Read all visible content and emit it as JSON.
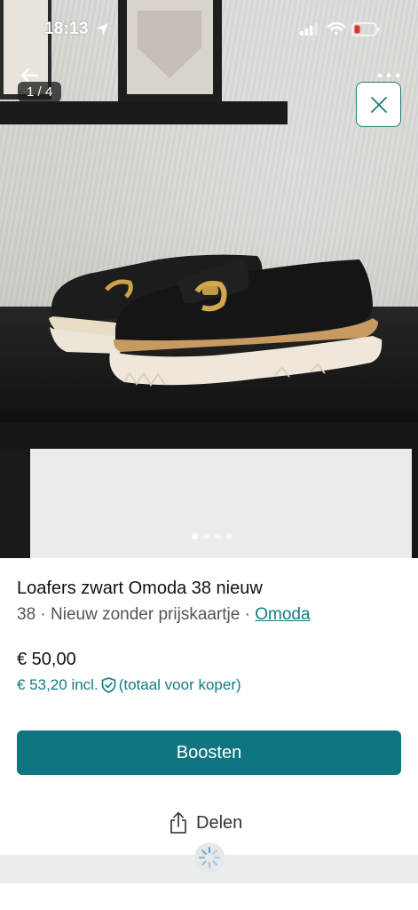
{
  "status_bar": {
    "time": "18:13",
    "icons": [
      "location-arrow-icon",
      "signal-icon",
      "wifi-icon",
      "battery-low-icon"
    ]
  },
  "gallery": {
    "counter": "1 / 4",
    "total_images": 4,
    "active_index": 1
  },
  "listing": {
    "title": "Loafers zwart Omoda 38 nieuw",
    "size": "38",
    "separator": "·",
    "condition": "Nieuw zonder prijskaartje",
    "brand": "Omoda",
    "price": "€ 50,00",
    "price_incl": "€ 53,20 incl.",
    "price_incl_note": "(totaal voor koper)"
  },
  "actions": {
    "boost_label": "Boosten",
    "share_label": "Delen"
  },
  "colors": {
    "accent": "#0f7580",
    "link": "#117a84",
    "battery_low": "#e0332b"
  }
}
